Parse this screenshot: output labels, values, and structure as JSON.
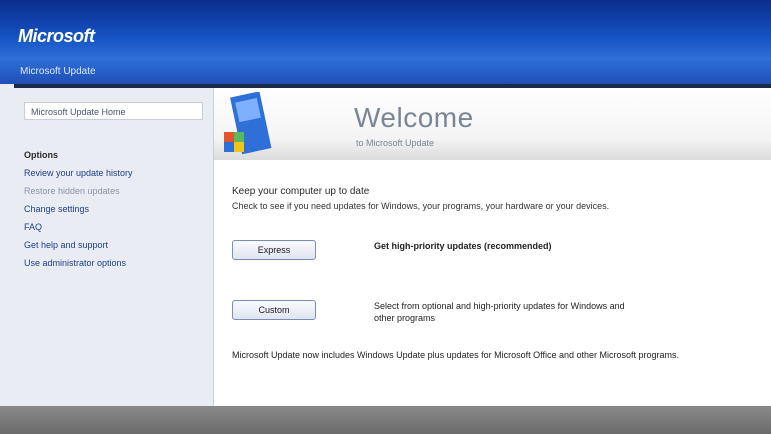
{
  "header": {
    "logo": "Microsoft",
    "subtitle": "Microsoft Update"
  },
  "sidebar": {
    "top_item": "Microsoft Update Home",
    "heading": "Options",
    "items": [
      {
        "label": "Review your update history",
        "muted": false
      },
      {
        "label": "Restore hidden updates",
        "muted": true
      },
      {
        "label": "Change settings",
        "muted": false
      },
      {
        "label": "FAQ",
        "muted": false
      },
      {
        "label": "Get help and support",
        "muted": false
      },
      {
        "label": "Use administrator options",
        "muted": false
      }
    ]
  },
  "banner": {
    "title": "Welcome",
    "subtitle": "to Microsoft Update"
  },
  "main": {
    "last_check": "Keep your computer up to date",
    "instructions": "Check to see if you need updates for Windows, your programs, your hardware or your devices.",
    "actions": [
      {
        "button": "Express",
        "description": "Get high-priority updates (recommended)",
        "bold": true
      },
      {
        "button": "Custom",
        "description": "Select from optional and high-priority updates for Windows and other programs",
        "bold": false
      }
    ],
    "footer_note": "Microsoft Update now includes Windows Update plus updates for Microsoft Office and other Microsoft programs."
  },
  "colors": {
    "header_blue": "#1553c4",
    "link_blue": "#1d3f8a"
  }
}
